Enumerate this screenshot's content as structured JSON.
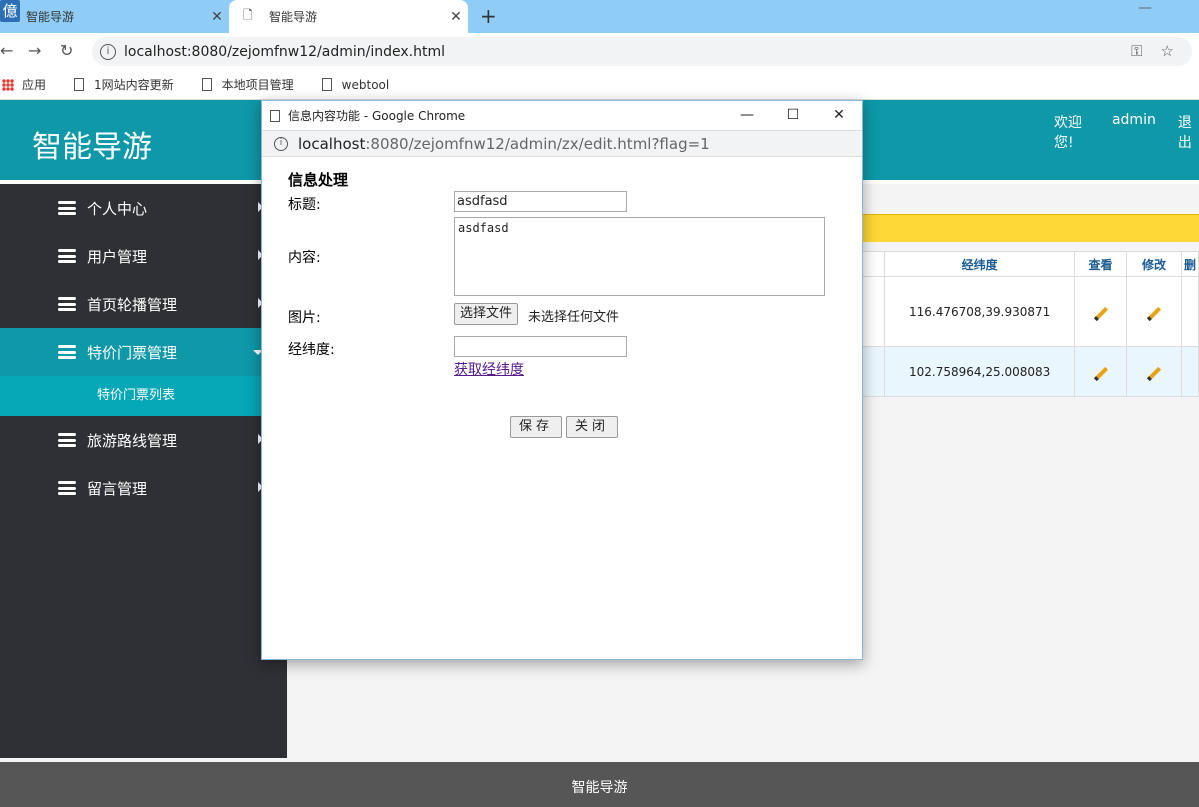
{
  "browser": {
    "tabs": [
      {
        "title": "智能导游"
      },
      {
        "title": "智能导游"
      }
    ],
    "url": "localhost:8080/zejomfnw12/admin/index.html",
    "bookmarks": [
      "应用",
      "1网站内容更新",
      "本地项目管理",
      "webtool"
    ]
  },
  "header": {
    "title": "智能导游",
    "welcome": "欢迎您!",
    "user": "admin",
    "logout": "退出"
  },
  "sidebar": {
    "items": [
      {
        "label": "个人中心"
      },
      {
        "label": "用户管理"
      },
      {
        "label": "首页轮播管理"
      },
      {
        "label": "特价门票管理"
      },
      {
        "label": "旅游路线管理"
      },
      {
        "label": "留言管理"
      }
    ],
    "subitem": "特价门票列表"
  },
  "table": {
    "headers": [
      "经纬度",
      "查看",
      "修改",
      "删"
    ],
    "rows": [
      {
        "latlng": "116.476708,39.930871"
      },
      {
        "latlng": "102.758964,25.008083"
      }
    ]
  },
  "footer": {
    "text": "智能导游"
  },
  "popup": {
    "window_title": "信息内容功能 - Google Chrome",
    "url_host": "localhost",
    "url_path": ":8080/zejomfnw12/admin/zx/edit.html?flag=1",
    "heading": "信息处理",
    "title_label": "标题:",
    "title_value": "asdfasd",
    "content_label": "内容:",
    "content_value": "asdfasd",
    "image_label": "图片:",
    "file_button": "选择文件",
    "file_status": "未选择任何文件",
    "latlng_label": "经纬度:",
    "latlng_value": "",
    "get_latlng_link": "获取经纬度",
    "save_button": "保存",
    "close_button": "关闭"
  }
}
